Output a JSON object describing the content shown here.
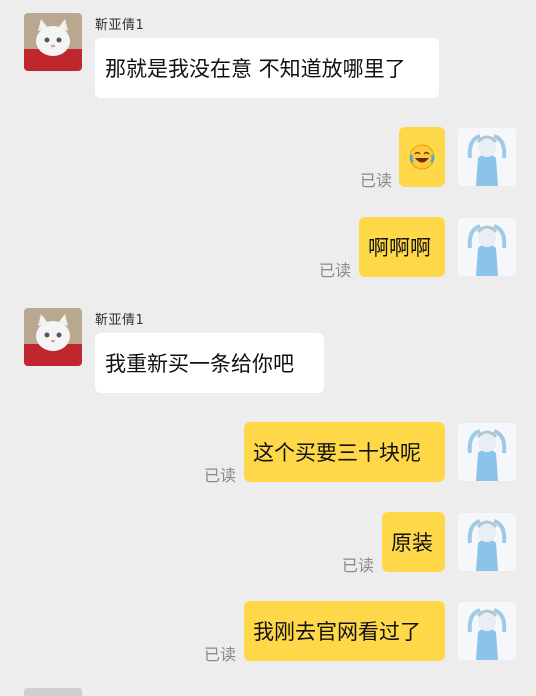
{
  "chat": {
    "contact_name": "靳亚倩1",
    "read_label": "已读",
    "messages": [
      {
        "side": "left",
        "text": "那就是我没在意 不知道放哪里了"
      },
      {
        "side": "right",
        "emoji": "laugh-cry",
        "text": ""
      },
      {
        "side": "right",
        "text": "啊啊啊"
      },
      {
        "side": "left",
        "text": "我重新买一条给你吧"
      },
      {
        "side": "right",
        "text": "这个买要三十块呢"
      },
      {
        "side": "right",
        "text": "原装"
      },
      {
        "side": "right",
        "text": "我刚去官网看过了"
      }
    ]
  },
  "colors": {
    "background": "#ededed",
    "self_bubble": "#ffd84a",
    "other_bubble": "#ffffff",
    "read_text": "#8a8a8a"
  }
}
